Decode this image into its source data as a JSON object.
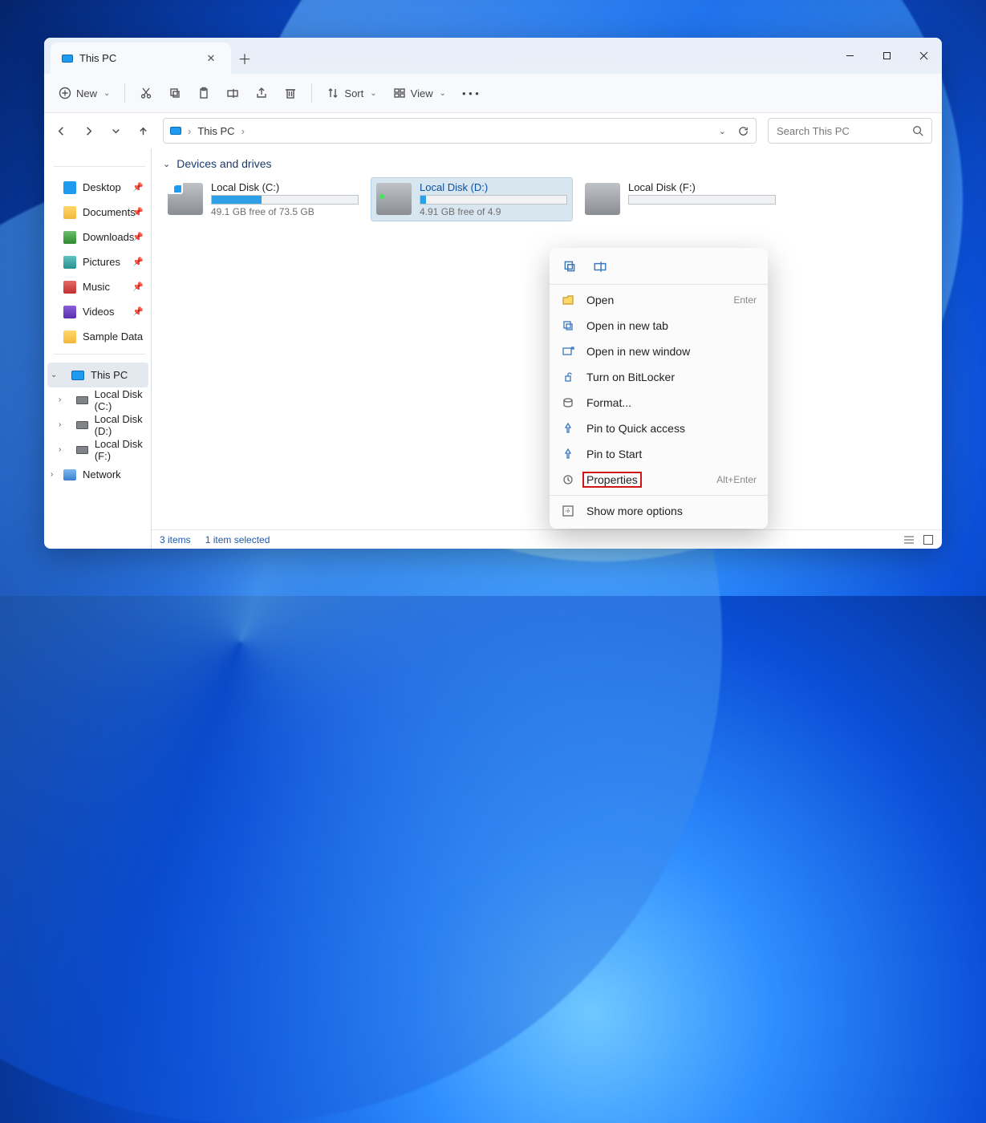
{
  "window": {
    "tab_title": "This PC",
    "new_button": "New",
    "sort_button": "Sort",
    "view_button": "View",
    "address": "This PC",
    "search_placeholder": "Search This PC"
  },
  "sidebar": {
    "quick": [
      {
        "label": "Desktop",
        "icon": "ic-blue"
      },
      {
        "label": "Documents",
        "icon": "ic-folder"
      },
      {
        "label": "Downloads",
        "icon": "ic-dl"
      },
      {
        "label": "Pictures",
        "icon": "ic-pic"
      },
      {
        "label": "Music",
        "icon": "ic-music"
      },
      {
        "label": "Videos",
        "icon": "ic-vid"
      },
      {
        "label": "Sample Data",
        "icon": "ic-folder"
      }
    ],
    "this_pc": "This PC",
    "drives": [
      "Local Disk (C:)",
      "Local Disk (D:)",
      "Local Disk (F:)"
    ],
    "network": "Network"
  },
  "group_header": "Devices and drives",
  "drives": [
    {
      "name": "Local Disk (C:)",
      "free": "49.1 GB free of 73.5 GB",
      "fill": 34
    },
    {
      "name": "Local Disk (D:)",
      "free": "4.91 GB free of 4.9",
      "fill": 4
    },
    {
      "name": "Local Disk (F:)",
      "free": "",
      "fill": 0
    }
  ],
  "status": {
    "items": "3 items",
    "selected": "1 item selected"
  },
  "context": {
    "items": [
      {
        "label": "Open",
        "hint": "Enter"
      },
      {
        "label": "Open in new tab",
        "hint": ""
      },
      {
        "label": "Open in new window",
        "hint": ""
      },
      {
        "label": "Turn on BitLocker",
        "hint": ""
      },
      {
        "label": "Format...",
        "hint": ""
      },
      {
        "label": "Pin to Quick access",
        "hint": ""
      },
      {
        "label": "Pin to Start",
        "hint": ""
      },
      {
        "label": "Properties",
        "hint": "Alt+Enter"
      }
    ],
    "more": "Show more options"
  }
}
